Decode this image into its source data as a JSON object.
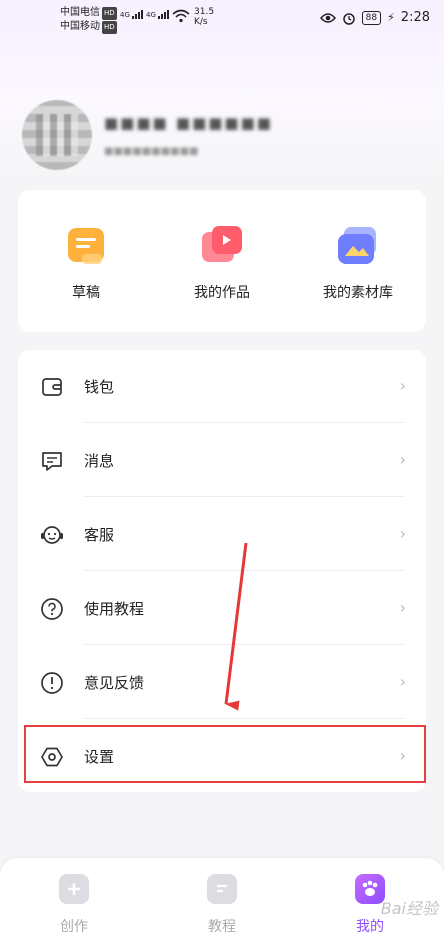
{
  "status_bar": {
    "carrier1": "中国电信",
    "carrier2": "中国移动",
    "hd": "HD",
    "network": "4G",
    "speed_value": "31.5",
    "speed_unit": "K/s",
    "battery": "88",
    "time": "2:28"
  },
  "quick_actions": [
    {
      "label": "草稿",
      "icon": "draft-icon",
      "color": "#ffb13d"
    },
    {
      "label": "我的作品",
      "icon": "works-icon",
      "color": "#ff6b7a"
    },
    {
      "label": "我的素材库",
      "icon": "material-library-icon",
      "color": "#7b8cff"
    }
  ],
  "menu": [
    {
      "label": "钱包",
      "icon": "wallet-icon"
    },
    {
      "label": "消息",
      "icon": "message-icon"
    },
    {
      "label": "客服",
      "icon": "customer-service-icon"
    },
    {
      "label": "使用教程",
      "icon": "help-icon"
    },
    {
      "label": "意见反馈",
      "icon": "feedback-icon"
    },
    {
      "label": "设置",
      "icon": "settings-icon"
    }
  ],
  "chevron": "›",
  "tabs": [
    {
      "label": "创作",
      "icon": "create-icon",
      "active": false
    },
    {
      "label": "教程",
      "icon": "tutorial-icon",
      "active": false
    },
    {
      "label": "我的",
      "icon": "me-icon",
      "active": true
    }
  ],
  "watermark": "Bai经验",
  "colors": {
    "accent": "#8c4dff",
    "highlight": "#e63f3f",
    "arrow": "#e53935"
  }
}
